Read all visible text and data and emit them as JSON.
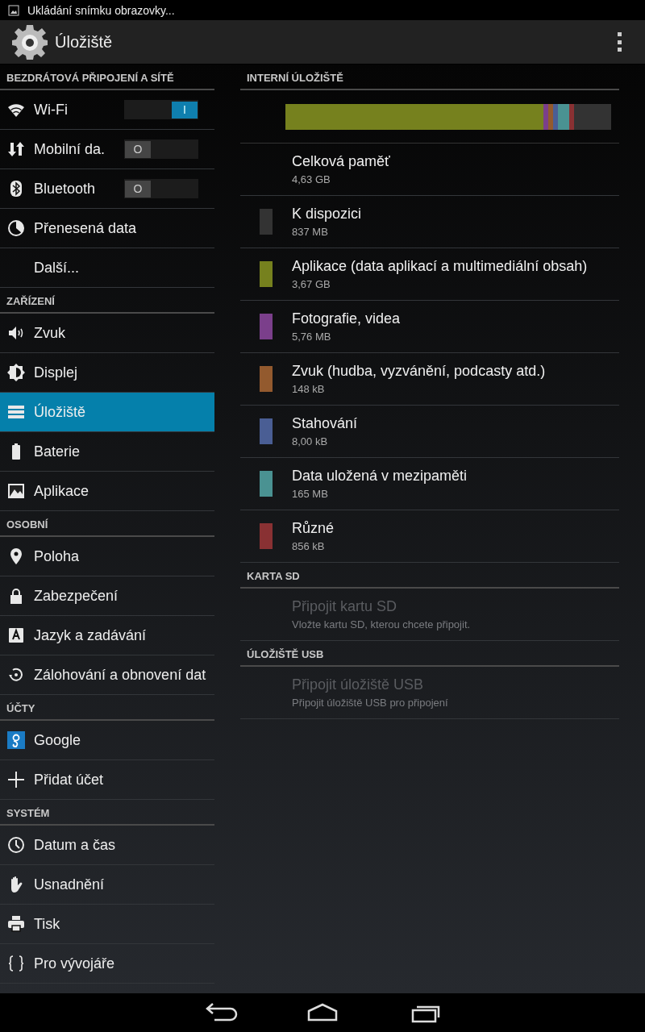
{
  "status_bar": {
    "notification": "Ukládání snímku obrazovky..."
  },
  "action_bar": {
    "title": "Úložiště"
  },
  "sidebar": {
    "sections": [
      {
        "header": "BEZDRÁTOVÁ PŘIPOJENÍ A SÍTĚ",
        "items": [
          {
            "label": "Wi-Fi",
            "kind": "toggle",
            "on": true,
            "thumb_label": "I",
            "selected": false
          },
          {
            "label": "Mobilní da.",
            "kind": "toggle",
            "on": false,
            "thumb_label": "O",
            "selected": false
          },
          {
            "label": "Bluetooth",
            "kind": "toggle",
            "on": false,
            "thumb_label": "O",
            "selected": false
          },
          {
            "label": "Přenesená data",
            "kind": "plain",
            "selected": false
          },
          {
            "label": "Další...",
            "kind": "plain",
            "selected": false
          }
        ]
      },
      {
        "header": "ZAŘÍZENÍ",
        "items": [
          {
            "label": "Zvuk",
            "kind": "plain",
            "selected": false
          },
          {
            "label": "Displej",
            "kind": "plain",
            "selected": false
          },
          {
            "label": "Úložiště",
            "kind": "plain",
            "selected": true
          },
          {
            "label": "Baterie",
            "kind": "plain",
            "selected": false
          },
          {
            "label": "Aplikace",
            "kind": "plain",
            "selected": false
          }
        ]
      },
      {
        "header": "OSOBNÍ",
        "items": [
          {
            "label": "Poloha",
            "kind": "plain",
            "selected": false
          },
          {
            "label": "Zabezpečení",
            "kind": "plain",
            "selected": false
          },
          {
            "label": "Jazyk a zadávání",
            "kind": "plain",
            "selected": false
          },
          {
            "label": "Zálohování a obnovení dat",
            "kind": "plain",
            "selected": false
          }
        ]
      },
      {
        "header": "ÚČTY",
        "items": [
          {
            "label": "Google",
            "kind": "plain",
            "selected": false
          },
          {
            "label": "Přidat účet",
            "kind": "plain",
            "selected": false
          }
        ]
      },
      {
        "header": "SYSTÉM",
        "items": [
          {
            "label": "Datum a čas",
            "kind": "plain",
            "selected": false
          },
          {
            "label": "Usnadnění",
            "kind": "plain",
            "selected": false
          },
          {
            "label": "Tisk",
            "kind": "plain",
            "selected": false
          },
          {
            "label": "Pro vývojáře",
            "kind": "plain",
            "selected": false
          }
        ]
      }
    ]
  },
  "storage": {
    "sections": [
      {
        "header": "INTERNÍ ÚLOŽIŠTĚ",
        "usage_bar": {
          "level": 0.887,
          "segments": [
            {
              "color": "#76811e"
            },
            {
              "color": "#7b3f8b"
            },
            {
              "color": "#935a2e"
            },
            {
              "color": "#4a5e94"
            },
            {
              "color": "#4a9292"
            },
            {
              "color": "#893133"
            }
          ]
        },
        "items": [
          {
            "title": "Celková paměť",
            "value": "4,63 GB",
            "disabled": false
          },
          {
            "title": "K dispozici",
            "value": "837 MB",
            "color": "#333333",
            "disabled": false
          },
          {
            "title": "Aplikace (data aplikací a multimediální obsah)",
            "value": "3,67 GB",
            "color": "#76811e",
            "disabled": false
          },
          {
            "title": "Fotografie, videa",
            "value": "5,76 MB",
            "color": "#7b3f8b",
            "disabled": false
          },
          {
            "title": "Zvuk (hudba, vyzvánění, podcasty atd.)",
            "value": "148 kB",
            "color": "#935a2e",
            "disabled": false
          },
          {
            "title": "Stahování",
            "value": "8,00 kB",
            "color": "#4a5e94",
            "disabled": false
          },
          {
            "title": "Data uložená v mezipaměti",
            "value": "165 MB",
            "color": "#4a9292",
            "disabled": false
          },
          {
            "title": "Různé",
            "value": "856 kB",
            "color": "#893133",
            "disabled": false
          }
        ]
      },
      {
        "header": "KARTA SD",
        "items": [
          {
            "title": "Připojit kartu SD",
            "value": "Vložte kartu SD, kterou chcete připojit.",
            "disabled": true
          }
        ]
      },
      {
        "header": "ÚLOŽIŠTĚ USB",
        "items": [
          {
            "title": "Připojit úložiště USB",
            "value": "Připojit úložiště USB pro připojení",
            "disabled": true
          }
        ]
      }
    ]
  }
}
